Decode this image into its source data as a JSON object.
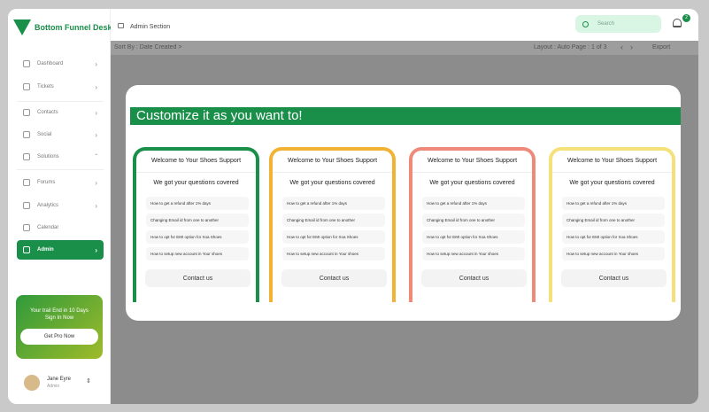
{
  "brand": {
    "name": "Bottom Funnel Desk"
  },
  "header": {
    "section": "Admin Section",
    "search_placeholder": "Search",
    "notification_count": "2"
  },
  "toolbar": {
    "sort": "Sort By : Date Created >",
    "layout": "Layout : Auto  Page : 1 of 3",
    "export": "Export"
  },
  "sidebar": {
    "items": [
      {
        "label": "Dashboard",
        "chev": "›"
      },
      {
        "label": "Tickets",
        "chev": "›"
      },
      {
        "label": "Contacts",
        "chev": "›"
      },
      {
        "label": "Social",
        "chev": "›"
      },
      {
        "label": "Solutions",
        "chev": "ˆ"
      },
      {
        "label": "Forums",
        "chev": "›"
      },
      {
        "label": "Analytics",
        "chev": "›"
      },
      {
        "label": "Calendar",
        "chev": ""
      },
      {
        "label": "Admin",
        "chev": "›"
      }
    ],
    "trial_line1": "Your trail End in 10 Days",
    "trial_line2": "Sign In Now",
    "trial_button": "Get Pro Now",
    "user_name": "Jane Eyre",
    "user_role": "Admin"
  },
  "modal": {
    "title": "Customize it as you want to!",
    "cards": [
      {
        "color": "#1a8f4a",
        "heading": "Welcome to Your Shoes Support",
        "subheading": "We got your questions covered",
        "faqs": [
          "How to get a refund after 1% days",
          "Changing Email id from one to another",
          "How to opt for EMI option for Xoa Shoes",
          "How to setup new account in Your shoes"
        ],
        "contact": "Contact us"
      },
      {
        "color": "#f2b233",
        "heading": "Welcome to Your Shoes Support",
        "subheading": "We got your questions covered",
        "faqs": [
          "How to get a refund after 1% days",
          "Changing Email id from one to another",
          "How to opt for EMI option for Xoa Shoes",
          "How to setup new account in Your shoes"
        ],
        "contact": "Contact us"
      },
      {
        "color": "#ef8a7a",
        "heading": "Welcome to Your Shoes Support",
        "subheading": "We got your questions covered",
        "faqs": [
          "How to get a refund after 1% days",
          "Changing Email id from one to another",
          "How to opt for EMI option for Xoa Shoes",
          "How to setup new account in Your shoes"
        ],
        "contact": "Contact us"
      },
      {
        "color": "#f5e07a",
        "heading": "Welcome to Your Shoes Support",
        "subheading": "We got your questions covered",
        "faqs": [
          "How to get a refund after 1% days",
          "Changing Email id from one to another",
          "How to opt for EMI option for Xoa Shoes",
          "How to setup new account in Your shoes"
        ],
        "contact": "Contact us"
      }
    ]
  }
}
